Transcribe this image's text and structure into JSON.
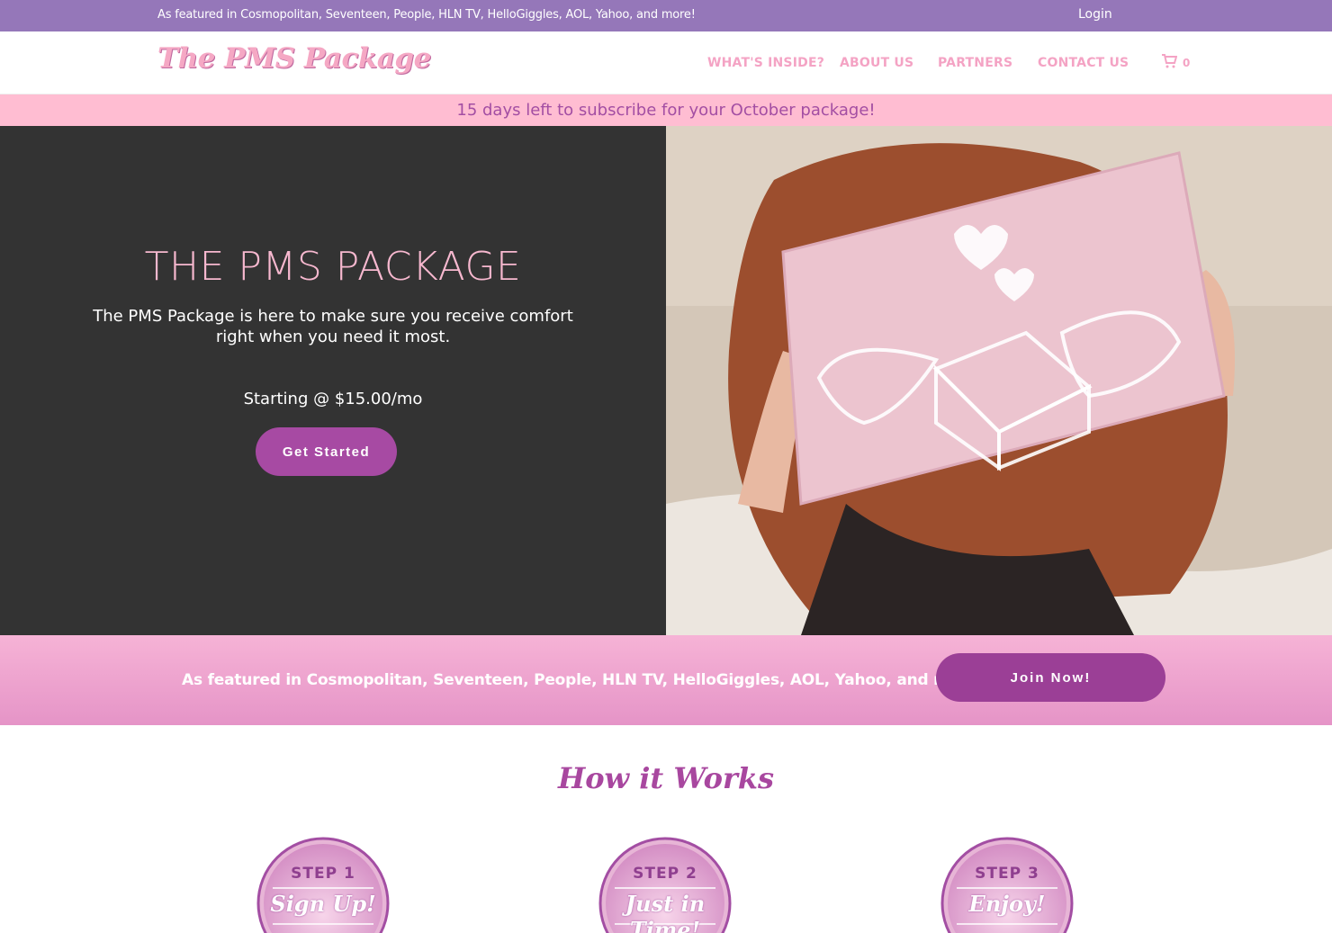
{
  "topbar": {
    "featured_text": "As featured in Cosmopolitan, Seventeen, People, HLN TV, HelloGiggles, AOL, Yahoo, and more!",
    "login_label": "Login"
  },
  "header": {
    "logo_text": "The PMS Package",
    "nav": [
      {
        "label": "WHAT'S INSIDE?"
      },
      {
        "label": "ABOUT US"
      },
      {
        "label": "PARTNERS"
      },
      {
        "label": "CONTACT US"
      }
    ],
    "cart_count": "0",
    "cart_icon": "shopping-cart-icon"
  },
  "countdown": {
    "text": "15 days left to subscribe for your October package!"
  },
  "hero": {
    "title": "THE PMS PACKAGE",
    "subtitle": "The PMS Package is here to make sure you receive comfort right when you need it most.",
    "price": "Starting @ $15.00/mo",
    "cta_label": "Get Started"
  },
  "featured": {
    "text": "As featured in Cosmopolitan, Seventeen, People, HLN TV, HelloGiggles, AOL, Yahoo, and more!",
    "cta_label": "Join Now!"
  },
  "how_it_works": {
    "title": "How it Works",
    "steps": [
      {
        "step": "STEP 1",
        "label": "Sign Up!"
      },
      {
        "step": "STEP 2",
        "label": "Just in Time!"
      },
      {
        "step": "STEP 3",
        "label": "Enjoy!"
      }
    ]
  },
  "colors": {
    "topbar": "#9577b9",
    "nav_pink": "#f4a3c4",
    "countdown_bg": "#ffbdd2",
    "hero_dark": "#333333",
    "button_purple": "#a74aa3"
  }
}
